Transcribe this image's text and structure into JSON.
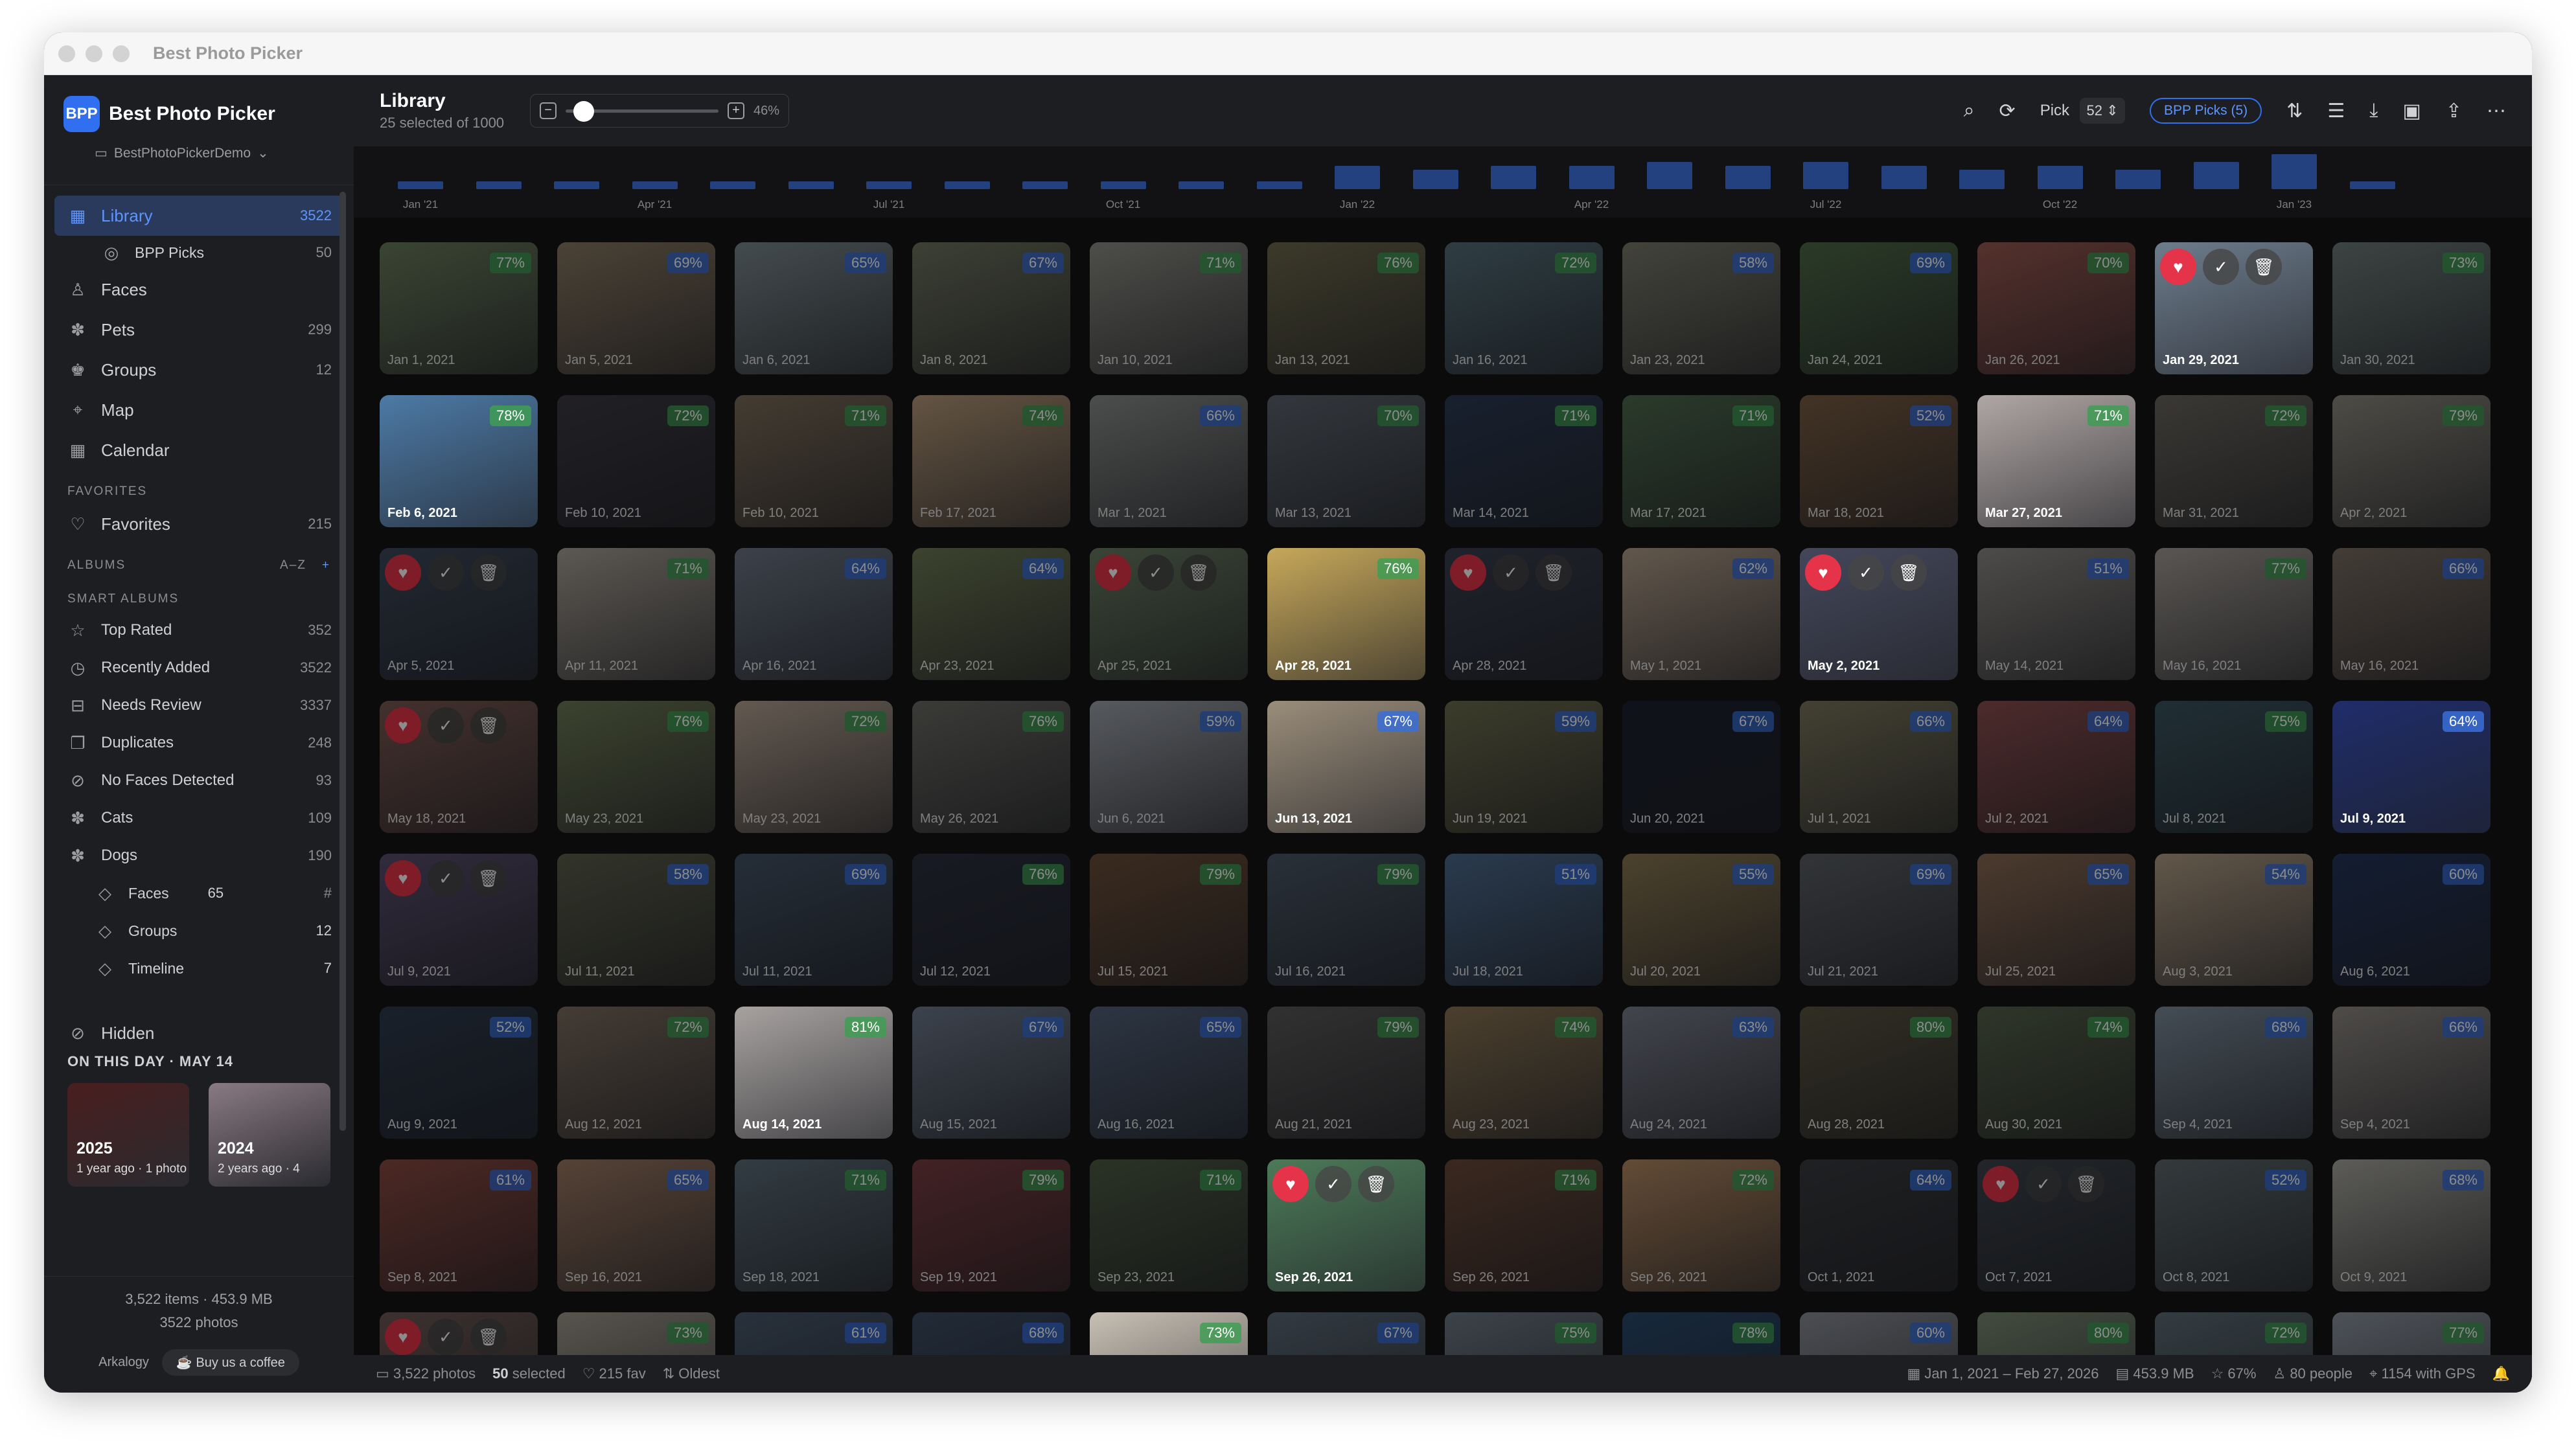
{
  "window": {
    "title": "Best Photo Picker"
  },
  "sidebar": {
    "logo": "BPP",
    "app_name": "Best Photo Picker",
    "library_selector": "BestPhotoPickerDemo",
    "items": [
      {
        "label": "Library",
        "count": "3522",
        "icon": "library-icon",
        "active": true
      },
      {
        "label": "BPP Picks",
        "count": "50",
        "icon": "check-circle-icon",
        "sub": true
      },
      {
        "label": "Faces",
        "count": "",
        "icon": "person-icon"
      },
      {
        "label": "Pets",
        "count": "299",
        "icon": "paw-icon"
      },
      {
        "label": "Groups",
        "count": "12",
        "icon": "group-icon"
      },
      {
        "label": "Map",
        "count": "",
        "icon": "map-pin-icon"
      },
      {
        "label": "Calendar",
        "count": "",
        "icon": "calendar-icon"
      }
    ],
    "favorites_header": "FAVORITES",
    "favorites": [
      {
        "label": "Favorites",
        "count": "215",
        "icon": "heart-icon"
      }
    ],
    "albums_header": "ALBUMS",
    "albums_sort": "A–Z",
    "albums_add": "+",
    "smart_header": "SMART ALBUMS",
    "smart": [
      {
        "label": "Top Rated",
        "count": "352",
        "icon": "star-icon"
      },
      {
        "label": "Recently Added",
        "count": "3522",
        "icon": "clock-icon"
      },
      {
        "label": "Needs Review",
        "count": "3337",
        "icon": "inbox-icon"
      },
      {
        "label": "Duplicates",
        "count": "248",
        "icon": "duplicate-icon"
      },
      {
        "label": "No Faces Detected",
        "count": "93",
        "icon": "no-face-icon"
      },
      {
        "label": "Cats",
        "count": "109",
        "icon": "paw-icon"
      },
      {
        "label": "Dogs",
        "count": "190",
        "icon": "paw-icon"
      }
    ],
    "groups": [
      {
        "label": "Faces",
        "count": "65",
        "extra": "#"
      },
      {
        "label": "Groups",
        "count": "12",
        "extra": ""
      },
      {
        "label": "Timeline",
        "count": "7",
        "extra": ""
      }
    ],
    "hidden": "Hidden",
    "on_this_day": "ON THIS DAY · MAY 14",
    "otd_cards": [
      {
        "year": "2025",
        "sub": "1 year ago · 1 photo"
      },
      {
        "year": "2024",
        "sub": "2 years ago · 4"
      }
    ],
    "footer_items": "3,522 items · 453.9 MB",
    "footer_photos": "3522 photos",
    "footer_brand": "Arkalogy",
    "coffee": "Buy us a coffee"
  },
  "toolbar": {
    "title": "Library",
    "subtitle": "25 selected of 1000",
    "zoom_pct": "46%",
    "zoom_level": 0.05,
    "pick_label": "Pick",
    "pick_value": "52",
    "bpp_picks": "BPP Picks (5)"
  },
  "timeline": {
    "labels": [
      {
        "text": "Jan '21",
        "pos": 0
      },
      {
        "text": "Apr '21",
        "pos": 3
      },
      {
        "text": "Jul '21",
        "pos": 6
      },
      {
        "text": "Oct '21",
        "pos": 9
      },
      {
        "text": "Jan '22",
        "pos": 12
      },
      {
        "text": "Apr '22",
        "pos": 15
      },
      {
        "text": "Jul '22",
        "pos": 18
      },
      {
        "text": "Oct '22",
        "pos": 21
      },
      {
        "text": "Jan '23",
        "pos": 24
      }
    ],
    "levels": [
      1,
      1,
      1,
      1,
      1,
      1,
      1,
      1,
      1,
      1,
      1,
      1,
      5,
      4,
      5,
      5,
      6,
      5,
      6,
      5,
      4,
      5,
      4,
      6,
      8,
      1
    ]
  },
  "photos": [
    {
      "date": "Jan 1, 2021",
      "score": "77%",
      "color": "#6b7d5d"
    },
    {
      "date": "Jan 5, 2021",
      "score": "69%",
      "color": "#8a7a64"
    },
    {
      "date": "Jan 6, 2021",
      "score": "65%",
      "color": "#7c8a8f"
    },
    {
      "date": "Jan 8, 2021",
      "score": "67%",
      "color": "#6f7560"
    },
    {
      "date": "Jan 10, 2021",
      "score": "71%",
      "color": "#8d8f86"
    },
    {
      "date": "Jan 13, 2021",
      "score": "76%",
      "color": "#6e6a4d"
    },
    {
      "date": "Jan 16, 2021",
      "score": "72%",
      "color": "#56707b"
    },
    {
      "date": "Jan 23, 2021",
      "score": "58%",
      "color": "#7b7b6e"
    },
    {
      "date": "Jan 24, 2021",
      "score": "69%",
      "color": "#4e6b48"
    },
    {
      "date": "Jan 26, 2021",
      "score": "70%",
      "color": "#9a5a52"
    },
    {
      "date": "Jan 29, 2021",
      "score": "",
      "color": "#6d7c8c",
      "bright": true,
      "actions": true
    },
    {
      "date": "Jan 30, 2021",
      "score": "73%",
      "color": "#6f7c7b"
    },
    {
      "date": "Feb 6, 2021",
      "score": "78%",
      "color": "#4d7aa6",
      "bright": true
    },
    {
      "date": "Feb 10, 2021",
      "score": "72%",
      "color": "#3d3b44"
    },
    {
      "date": "Feb 10, 2021",
      "score": "71%",
      "color": "#7d6e5b"
    },
    {
      "date": "Feb 17, 2021",
      "score": "74%",
      "color": "#b69a7a"
    },
    {
      "date": "Mar 1, 2021",
      "score": "66%",
      "color": "#8a8e8c"
    },
    {
      "date": "Mar 13, 2021",
      "score": "70%",
      "color": "#5e6670"
    },
    {
      "date": "Mar 14, 2021",
      "score": "71%",
      "color": "#2d3c55"
    },
    {
      "date": "Mar 17, 2021",
      "score": "71%",
      "color": "#4e6b4e"
    },
    {
      "date": "Mar 18, 2021",
      "score": "52%",
      "color": "#7a5e44"
    },
    {
      "date": "Mar 27, 2021",
      "score": "71%",
      "color": "#b0a7a5",
      "bright": true
    },
    {
      "date": "Mar 31, 2021",
      "score": "72%",
      "color": "#6b6760"
    },
    {
      "date": "Apr 2, 2021",
      "score": "79%",
      "color": "#8d8a80"
    },
    {
      "date": "Apr 5, 2021",
      "score": "",
      "color": "#3e4a5c",
      "actions": true
    },
    {
      "date": "Apr 11, 2021",
      "score": "71%",
      "color": "#a8a197"
    },
    {
      "date": "Apr 16, 2021",
      "score": "64%",
      "color": "#6d7887"
    },
    {
      "date": "Apr 23, 2021",
      "score": "64%",
      "color": "#6e7a55"
    },
    {
      "date": "Apr 25, 2021",
      "score": "",
      "color": "#6a7d63",
      "actions": true
    },
    {
      "date": "Apr 28, 2021",
      "score": "76%",
      "color": "#c7a85a",
      "bright": true
    },
    {
      "date": "Apr 28, 2021",
      "score": "",
      "color": "#3a4050",
      "actions": true
    },
    {
      "date": "May 1, 2021",
      "score": "62%",
      "color": "#b29f8b"
    },
    {
      "date": "May 2, 2021",
      "score": "",
      "color": "#44475a",
      "bright": true,
      "actions": true
    },
    {
      "date": "May 14, 2021",
      "score": "51%",
      "color": "#8e8a86"
    },
    {
      "date": "May 16, 2021",
      "score": "77%",
      "color": "#a39d97"
    },
    {
      "date": "May 16, 2021",
      "score": "66%",
      "color": "#7a6e63"
    },
    {
      "date": "May 18, 2021",
      "score": "",
      "color": "#7b5a54",
      "actions": true
    },
    {
      "date": "May 23, 2021",
      "score": "76%",
      "color": "#6e7a56"
    },
    {
      "date": "May 23, 2021",
      "score": "72%",
      "color": "#b4a393"
    },
    {
      "date": "May 26, 2021",
      "score": "76%",
      "color": "#6b6b66"
    },
    {
      "date": "Jun 6, 2021",
      "score": "59%",
      "color": "#9ea3ab"
    },
    {
      "date": "Jun 13, 2021",
      "score": "67%",
      "color": "#9a8d7a",
      "bright": true
    },
    {
      "date": "Jun 19, 2021",
      "score": "59%",
      "color": "#6e6e50"
    },
    {
      "date": "Jun 20, 2021",
      "score": "67%",
      "color": "#1d2230"
    },
    {
      "date": "Jul 1, 2021",
      "score": "66%",
      "color": "#7b775d"
    },
    {
      "date": "Jul 2, 2021",
      "score": "64%",
      "color": "#8c4f4f"
    },
    {
      "date": "Jul 8, 2021",
      "score": "75%",
      "color": "#3b5660"
    },
    {
      "date": "Jul 9, 2021",
      "score": "64%",
      "color": "#1f2d6a",
      "bright": true
    },
    {
      "date": "Jul 9, 2021",
      "score": "",
      "color": "#5a4f6e",
      "actions": true
    },
    {
      "date": "Jul 11, 2021",
      "score": "58%",
      "color": "#5c5f4c"
    },
    {
      "date": "Jul 11, 2021",
      "score": "69%",
      "color": "#445466"
    },
    {
      "date": "Jul 12, 2021",
      "score": "76%",
      "color": "#2c3140"
    },
    {
      "date": "Jul 15, 2021",
      "score": "79%",
      "color": "#6b4f3a"
    },
    {
      "date": "Jul 16, 2021",
      "score": "79%",
      "color": "#4b5868"
    },
    {
      "date": "Jul 18, 2021",
      "score": "51%",
      "color": "#4d6b8e"
    },
    {
      "date": "Jul 20, 2021",
      "score": "55%",
      "color": "#8a7853"
    },
    {
      "date": "Jul 21, 2021",
      "score": "69%",
      "color": "#5c6066"
    },
    {
      "date": "Jul 25, 2021",
      "score": "65%",
      "color": "#8a6b55"
    },
    {
      "date": "Aug 3, 2021",
      "score": "54%",
      "color": "#b29f87"
    },
    {
      "date": "Aug 6, 2021",
      "score": "60%",
      "color": "#25365a"
    },
    {
      "date": "Aug 9, 2021",
      "score": "52%",
      "color": "#2f3c4e"
    },
    {
      "date": "Aug 12, 2021",
      "score": "72%",
      "color": "#7d6e60"
    },
    {
      "date": "Aug 14, 2021",
      "score": "81%",
      "color": "#a7a2a0",
      "bright": true
    },
    {
      "date": "Aug 15, 2021",
      "score": "67%",
      "color": "#6e7a8c"
    },
    {
      "date": "Aug 16, 2021",
      "score": "65%",
      "color": "#52627a"
    },
    {
      "date": "Aug 21, 2021",
      "score": "79%",
      "color": "#5a5a5a"
    },
    {
      "date": "Aug 23, 2021",
      "score": "74%",
      "color": "#8a7556"
    },
    {
      "date": "Aug 24, 2021",
      "score": "63%",
      "color": "#7a7e8c"
    },
    {
      "date": "Aug 28, 2021",
      "score": "80%",
      "color": "#5a5542"
    },
    {
      "date": "Aug 30, 2021",
      "score": "74%",
      "color": "#56624a"
    },
    {
      "date": "Sep 4, 2021",
      "score": "68%",
      "color": "#7c8b9a"
    },
    {
      "date": "Sep 4, 2021",
      "score": "66%",
      "color": "#8f8a85"
    },
    {
      "date": "Sep 8, 2021",
      "score": "61%",
      "color": "#8a4a42"
    },
    {
      "date": "Sep 16, 2021",
      "score": "65%",
      "color": "#9c7a64"
    },
    {
      "date": "Sep 18, 2021",
      "score": "71%",
      "color": "#5c6e7a"
    },
    {
      "date": "Sep 19, 2021",
      "score": "79%",
      "color": "#7a3e42"
    },
    {
      "date": "Sep 23, 2021",
      "score": "71%",
      "color": "#4e5c44"
    },
    {
      "date": "Sep 26, 2021",
      "score": "",
      "color": "#4c7a58",
      "bright": true,
      "actions": true
    },
    {
      "date": "Sep 26, 2021",
      "score": "71%",
      "color": "#6b4a3a"
    },
    {
      "date": "Sep 26, 2021",
      "score": "72%",
      "color": "#b48a64"
    },
    {
      "date": "Oct 1, 2021",
      "score": "64%",
      "color": "#3a3c40"
    },
    {
      "date": "Oct 7, 2021",
      "score": "",
      "color": "#3e444c",
      "actions": true
    },
    {
      "date": "Oct 8, 2021",
      "score": "52%",
      "color": "#5e6a6e"
    },
    {
      "date": "Oct 9, 2021",
      "score": "68%",
      "color": "#a8a7a0"
    },
    {
      "date": "",
      "score": "",
      "color": "#6e5a56",
      "actions": true
    },
    {
      "date": "",
      "score": "73%",
      "color": "#a09a8e"
    },
    {
      "date": "",
      "score": "61%",
      "color": "#4a5a6e"
    },
    {
      "date": "",
      "score": "68%",
      "color": "#3e4e66"
    },
    {
      "date": "",
      "score": "73%",
      "color": "#c8c0b4",
      "bright": true
    },
    {
      "date": "",
      "score": "67%",
      "color": "#5c6a78"
    },
    {
      "date": "",
      "score": "75%",
      "color": "#6e7a86"
    },
    {
      "date": "",
      "score": "78%",
      "color": "#2a4a6e"
    },
    {
      "date": "",
      "score": "60%",
      "color": "#8a8e96"
    },
    {
      "date": "",
      "score": "80%",
      "color": "#7a8a74"
    },
    {
      "date": "",
      "score": "72%",
      "color": "#5e6e76"
    },
    {
      "date": "",
      "score": "77%",
      "color": "#8e96a0"
    }
  ],
  "status": {
    "photos": "3,522 photos",
    "selected_count": "50",
    "selected_label": "selected",
    "fav": "215 fav",
    "sort": "Oldest",
    "range": "Jan 1, 2021 – Feb 27, 2026",
    "size": "453.9 MB",
    "quality": "67%",
    "people": "80 people",
    "gps": "1154 with GPS"
  },
  "colors": {
    "accent": "#2f6ff0",
    "score_green": "#3f9e55",
    "score_blue": "#3a6fd8",
    "heart": "#e5334a"
  }
}
